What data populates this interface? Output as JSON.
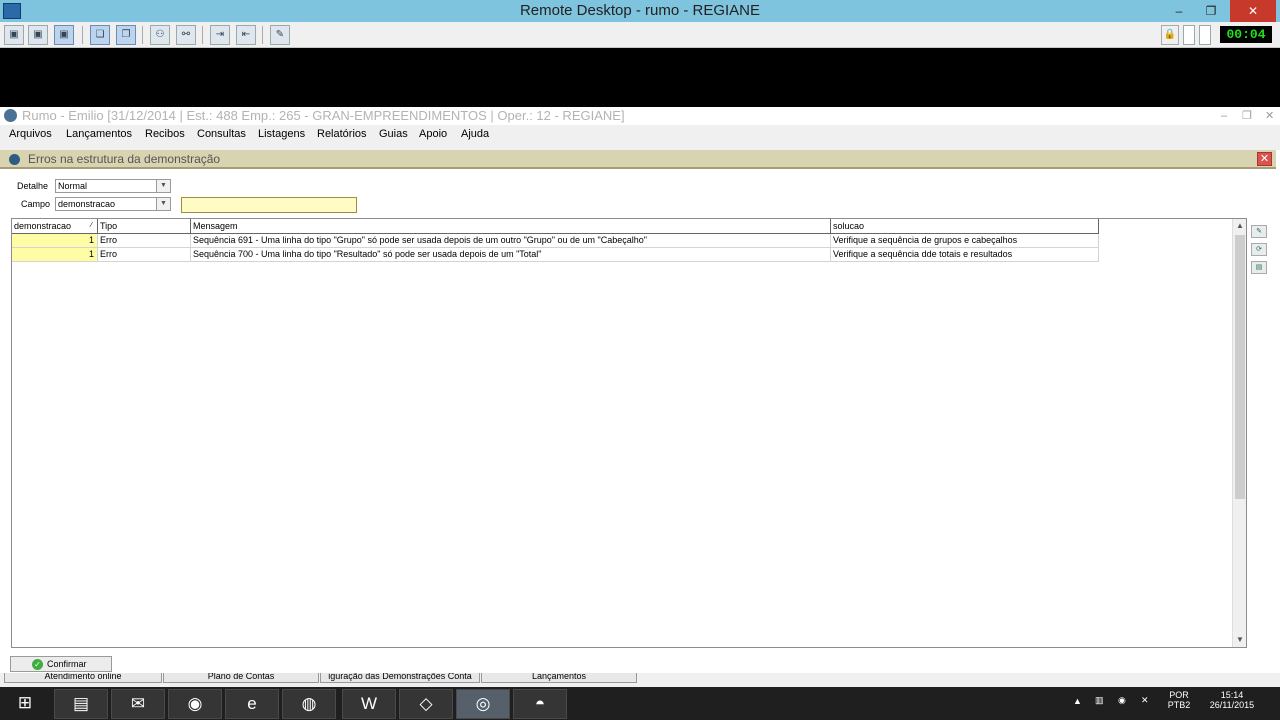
{
  "remote": {
    "title": "Remote Desktop - rumo - REGIANE",
    "minimize_icon": "–",
    "restore_icon": "❐",
    "close_icon": "✕",
    "timer": "00:04"
  },
  "app": {
    "title": "Rumo - Emilio [31/12/2014 | Est.: 488 Emp.: 265 - GRAN-EMPREENDIMENTOS | Oper.: 12 - REGIANE]",
    "menu": [
      "Arquivos",
      "Lançamentos",
      "Recibos",
      "Consultas",
      "Listagens",
      "Relatórios",
      "Guias",
      "Apoio",
      "Ajuda"
    ]
  },
  "form": {
    "title": "Erros na estrutura da demonstração",
    "close_icon": "✕",
    "detalhe_label": "Detalhe",
    "detalhe_value": "Normal",
    "campo_label": "Campo",
    "campo_value": "demonstracao",
    "search_value": "",
    "columns": [
      "demonstracao",
      "Tipo",
      "Mensagem",
      "solucao"
    ],
    "rows": [
      {
        "demonstracao": "1",
        "tipo": "Erro",
        "mensagem": "Sequência 691 - Uma linha do tipo \"Grupo\" só pode ser usada depois de um outro \"Grupo\" ou de um \"Cabeçalho\"",
        "solucao": "Verifique a sequência de grupos e cabeçalhos"
      },
      {
        "demonstracao": "1",
        "tipo": "Erro",
        "mensagem": "Sequência 700 - Uma linha do tipo \"Resultado\" só pode ser usada depois de um \"Total\"",
        "solucao": "Verifique a sequência dde totais e resultados"
      }
    ],
    "confirm_label": "Confirmar"
  },
  "tabs": [
    "Atendimento online",
    "Plano de Contas",
    "iguração das Demonstrações Conta",
    "Lançamentos"
  ],
  "tray": {
    "lang1": "POR",
    "lang2": "PTB2",
    "time": "15:14",
    "date": "26/11/2015"
  },
  "colors": {
    "remote_bar": "#7ec4de",
    "highlight_yellow": "#fffca6",
    "form_header": "#d8d3b0",
    "taskbar": "#1f1f1f"
  }
}
